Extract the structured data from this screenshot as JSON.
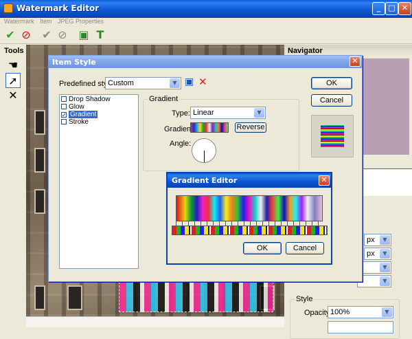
{
  "window": {
    "title": "Watermark Editor"
  },
  "menu": [
    "Watermark",
    "Item",
    "JPEG Properties"
  ],
  "tools_panel": {
    "label": "Tools"
  },
  "navigator": {
    "title": "Navigator"
  },
  "item_style": {
    "title": "Item Style",
    "predefined_label": "Predefined style:",
    "predefined_value": "Custom",
    "effects": [
      {
        "label": "Drop Shadow",
        "checked": false
      },
      {
        "label": "Glow",
        "checked": false
      },
      {
        "label": "Gradient",
        "checked": true
      },
      {
        "label": "Stroke",
        "checked": false
      }
    ],
    "gradient_group": "Gradient",
    "type_label": "Type:",
    "type_value": "Linear",
    "gradient_label": "Gradient:",
    "reverse_label": "Reverse",
    "angle_label": "Angle:",
    "ok": "OK",
    "cancel": "Cancel"
  },
  "gradient_editor": {
    "title": "Gradient Editor",
    "ok": "OK",
    "cancel": "Cancel"
  },
  "properties": {
    "unit1": "px",
    "unit2": "px",
    "style_group": "Style",
    "opacity_label": "Opacity:",
    "opacity_value": "100%"
  }
}
